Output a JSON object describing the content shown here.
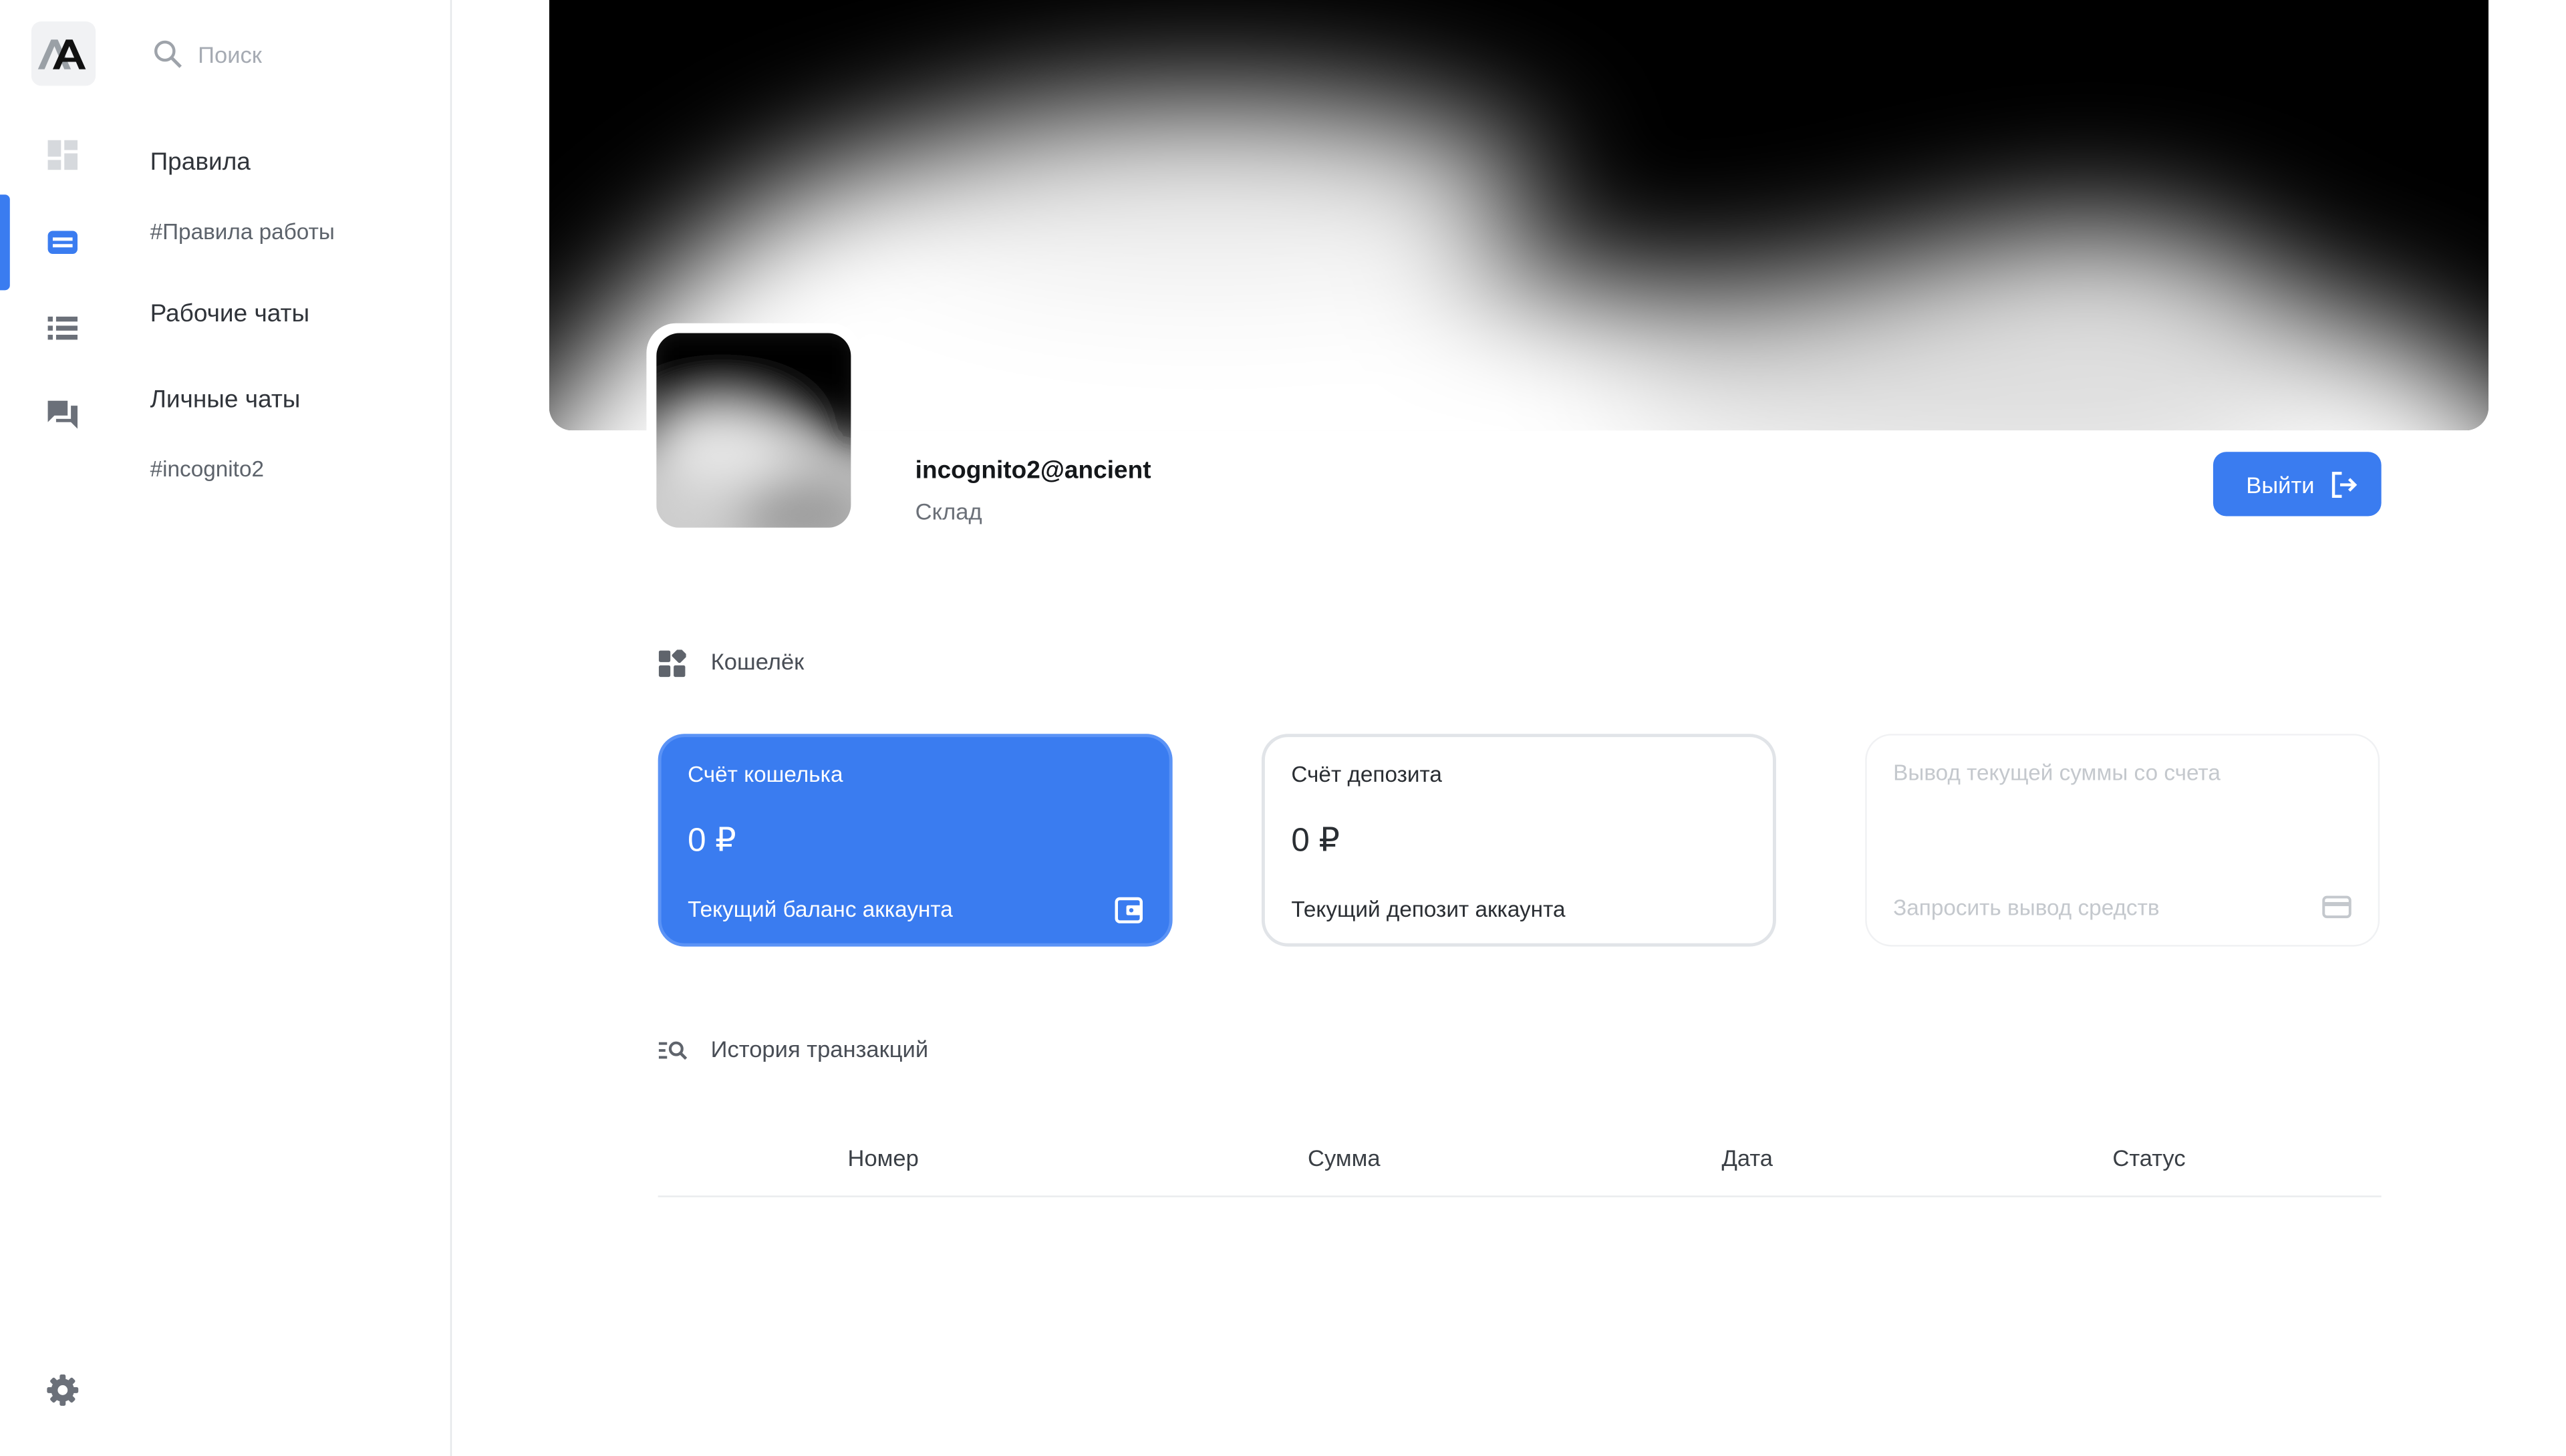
{
  "sidebar": {
    "search_placeholder": "Поиск",
    "rules_title": "Правила",
    "rules_link": "#Правила работы",
    "work_chats_title": "Рабочие чаты",
    "personal_chats_title": "Личные чаты",
    "personal_chat_link": "#incognito2"
  },
  "profile": {
    "username": "incognito2@ancient",
    "role": "Склад",
    "logout_label": "Выйти"
  },
  "wallet": {
    "section_title": "Кошелёк",
    "cards": [
      {
        "title": "Счёт кошелька",
        "amount": "0 ₽",
        "subtitle": "Текущий баланс аккаунта"
      },
      {
        "title": "Счёт депозита",
        "amount": "0 ₽",
        "subtitle": "Текущий депозит аккаунта"
      },
      {
        "title": "Вывод текущей суммы со счета",
        "subtitle": "Запросить вывод средств"
      }
    ]
  },
  "transactions": {
    "section_title": "История транзакций",
    "columns": [
      "Номер",
      "Сумма",
      "Дата",
      "Статус"
    ]
  },
  "colors": {
    "accent": "#3a7cf0",
    "border": "#e6e8eb",
    "icon_gray": "#6b7079"
  }
}
